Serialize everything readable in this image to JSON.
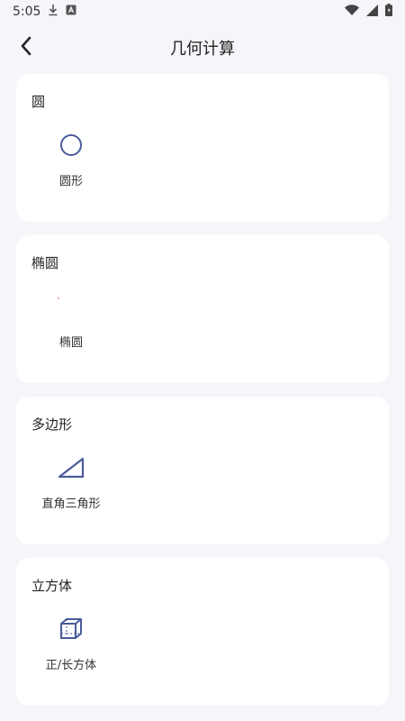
{
  "status_bar": {
    "time": "5:05",
    "icons": [
      "download-icon",
      "a-icon",
      "wifi-icon",
      "signal-icon",
      "battery-icon"
    ]
  },
  "header": {
    "title": "几何计算",
    "back_icon": "chevron-left-icon"
  },
  "colors": {
    "accent": "#4a5a9a",
    "background": "#f5f6fa",
    "card": "#ffffff"
  },
  "sections": [
    {
      "title": "圆",
      "items": [
        {
          "label": "圆形",
          "icon": "circle-icon"
        }
      ]
    },
    {
      "title": "椭圆",
      "items": [
        {
          "label": "椭圆",
          "icon": "ellipse-icon"
        }
      ]
    },
    {
      "title": "多边形",
      "items": [
        {
          "label": "直角三角形",
          "icon": "right-triangle-icon"
        }
      ]
    },
    {
      "title": "立方体",
      "items": [
        {
          "label": "正/长方体",
          "icon": "cuboid-icon"
        }
      ]
    }
  ]
}
